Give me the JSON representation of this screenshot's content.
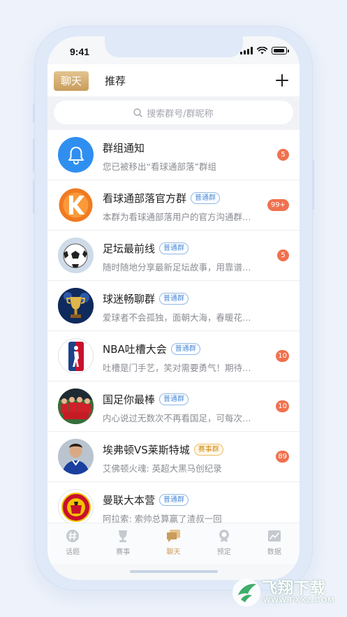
{
  "status_bar": {
    "time": "9:41"
  },
  "header": {
    "tabs": [
      {
        "label": "聊天",
        "active": true
      },
      {
        "label": "推荐",
        "active": false
      }
    ],
    "add_icon": "plus-icon"
  },
  "search": {
    "placeholder": "搜索群号/群昵称",
    "icon": "search-icon"
  },
  "chats": [
    {
      "title": "群组通知",
      "tag": "",
      "preview": "您已被移出“看球通部落”群组",
      "badge": "5",
      "avatar": "bell-icon"
    },
    {
      "title": "看球通部落官方群",
      "tag": "普通群",
      "preview": "本群为看球通部落用户的官方沟通群…",
      "badge": "99+",
      "avatar": "k-logo"
    },
    {
      "title": "足坛最前线",
      "tag": "普通群",
      "preview": "随时随地分享最新足坛故事，用靠谱…",
      "badge": "5",
      "avatar": "soccer-ball"
    },
    {
      "title": "球迷畅聊群",
      "tag": "普通群",
      "preview": "爱球者不会孤独，面朝大海，春暖花…",
      "badge": "",
      "avatar": "trophy"
    },
    {
      "title": "NBA吐槽大会",
      "tag": "普通群",
      "preview": "吐槽是门手艺，笑对需要勇气！期待…",
      "badge": "10",
      "avatar": "nba-logo"
    },
    {
      "title": "国足你最棒",
      "tag": "普通群",
      "preview": "内心说过无数次不再看国足，可每次…",
      "badge": "10",
      "avatar": "team-photo"
    },
    {
      "title": "埃弗顿VS莱斯特城",
      "tag": "赛事群",
      "preview": "艾佛顿火魂: 英超大黑马创纪录",
      "badge": "89",
      "avatar": "player-photo"
    },
    {
      "title": "曼联大本营",
      "tag": "普通群",
      "preview": "阿拉索: 索帅总算赢了渣叔一回",
      "badge": "",
      "avatar": "manutd-crest"
    }
  ],
  "tabbar": [
    {
      "label": "话题",
      "icon": "hash-icon",
      "active": false
    },
    {
      "label": "赛事",
      "icon": "trophy-icon",
      "active": false
    },
    {
      "label": "聊天",
      "icon": "chat-icon",
      "active": true
    },
    {
      "label": "预定",
      "icon": "medal-icon",
      "active": false
    },
    {
      "label": "数据",
      "icon": "chart-icon",
      "active": false
    }
  ],
  "watermark": {
    "text": "飞翔下载",
    "url": "WWW.FXXZ.COM"
  },
  "colors": {
    "accent": "#c99c5d",
    "badge": "#f0714f",
    "tag": "#4a8bd8",
    "event_tag": "#d08b16"
  }
}
